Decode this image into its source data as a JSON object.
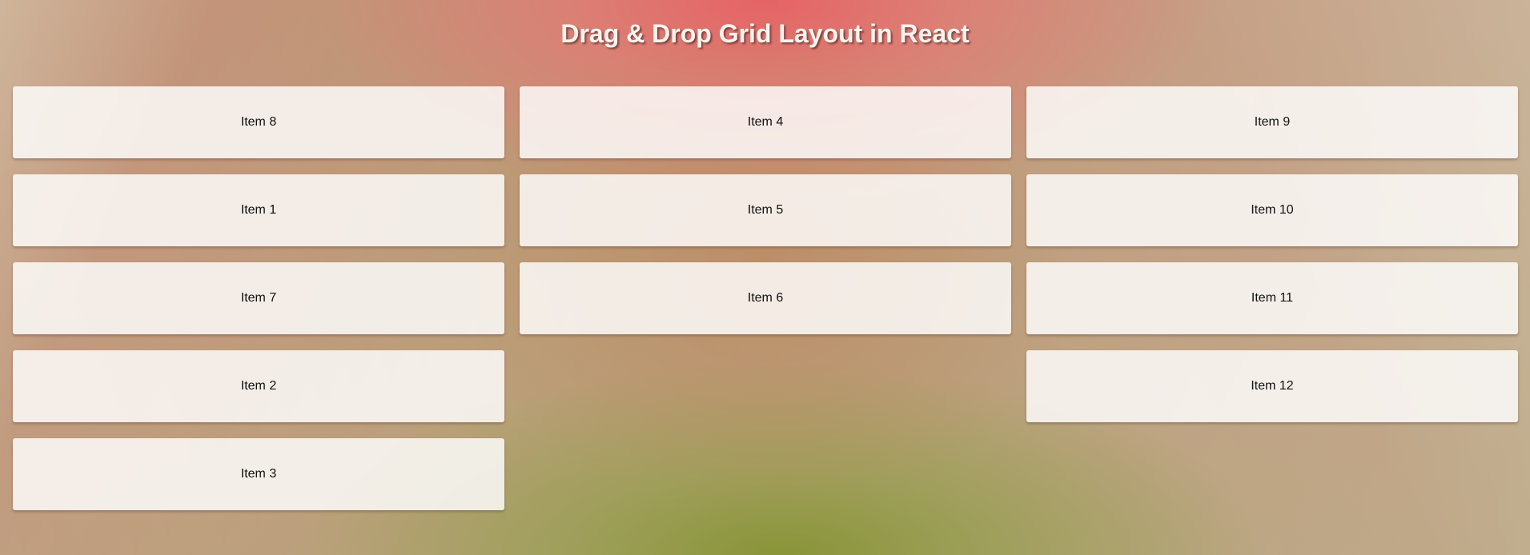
{
  "page": {
    "title": "Drag & Drop Grid Layout in React"
  },
  "columns": [
    {
      "items": [
        "Item 8",
        "Item 1",
        "Item 7",
        "Item 2",
        "Item 3"
      ]
    },
    {
      "items": [
        "Item 4",
        "Item 5",
        "Item 6"
      ]
    },
    {
      "items": [
        "Item 9",
        "Item 10",
        "Item 11",
        "Item 12"
      ]
    }
  ],
  "colors": {
    "top_accent": "#e8605f",
    "bottom_accent": "#86942f",
    "card_background": "#f7f0ec",
    "title_text": "#fbf3ee"
  }
}
